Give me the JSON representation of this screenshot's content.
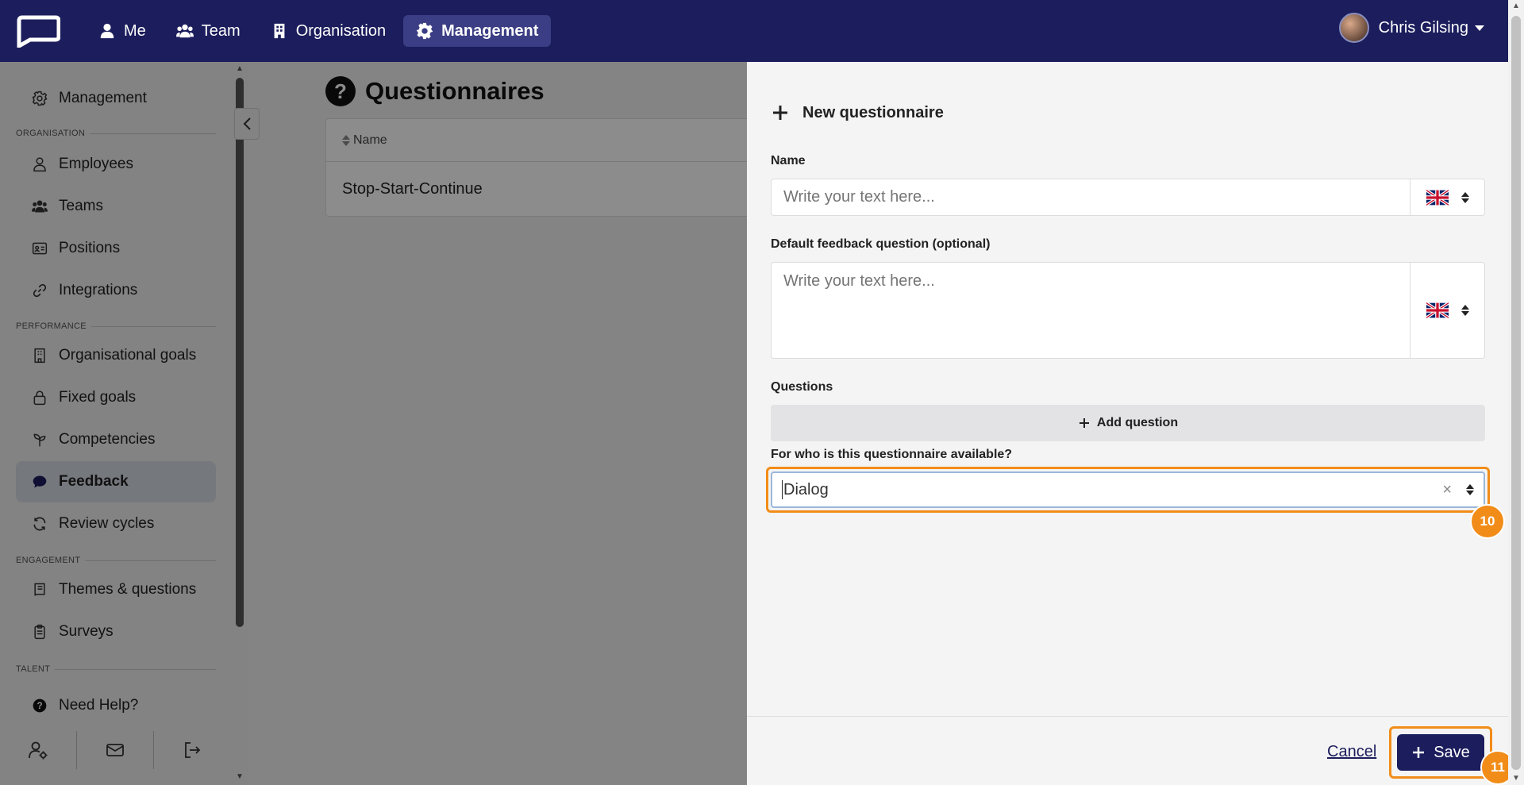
{
  "nav": {
    "items": [
      {
        "label": "Me",
        "icon": "user-icon"
      },
      {
        "label": "Team",
        "icon": "users-icon"
      },
      {
        "label": "Organisation",
        "icon": "building-icon"
      },
      {
        "label": "Management",
        "icon": "gear-icon",
        "active": true
      }
    ],
    "user_name": "Chris Gilsing"
  },
  "sidebar": {
    "top_item": "Management",
    "sections": {
      "organisation": "ORGANISATION",
      "performance": "PERFORMANCE",
      "engagement": "ENGAGEMENT",
      "talent": "TALENT"
    },
    "organisation_items": [
      "Employees",
      "Teams",
      "Positions",
      "Integrations"
    ],
    "performance_items": [
      "Organisational goals",
      "Fixed goals",
      "Competencies",
      "Feedback",
      "Review cycles"
    ],
    "engagement_items": [
      "Themes & questions",
      "Surveys"
    ],
    "help": "Need Help?"
  },
  "main": {
    "title": "Questionnaires",
    "table": {
      "header": "Name",
      "rows": [
        "Stop-Start-Continue"
      ]
    }
  },
  "panel": {
    "title": "New questionnaire",
    "name_label": "Name",
    "name_placeholder": "Write your text here...",
    "default_q_label": "Default feedback question (optional)",
    "default_q_placeholder": "Write your text here...",
    "questions_label": "Questions",
    "add_question": "Add question",
    "availability_label": "For who is this questionnaire available?",
    "availability_value": "Dialog",
    "cancel": "Cancel",
    "save": "Save"
  },
  "annotations": {
    "step_10": "10",
    "step_11": "11"
  },
  "colors": {
    "nav_bg": "#1b1d5c",
    "highlight": "#f28c18",
    "save_bg": "#1b1d5c"
  }
}
